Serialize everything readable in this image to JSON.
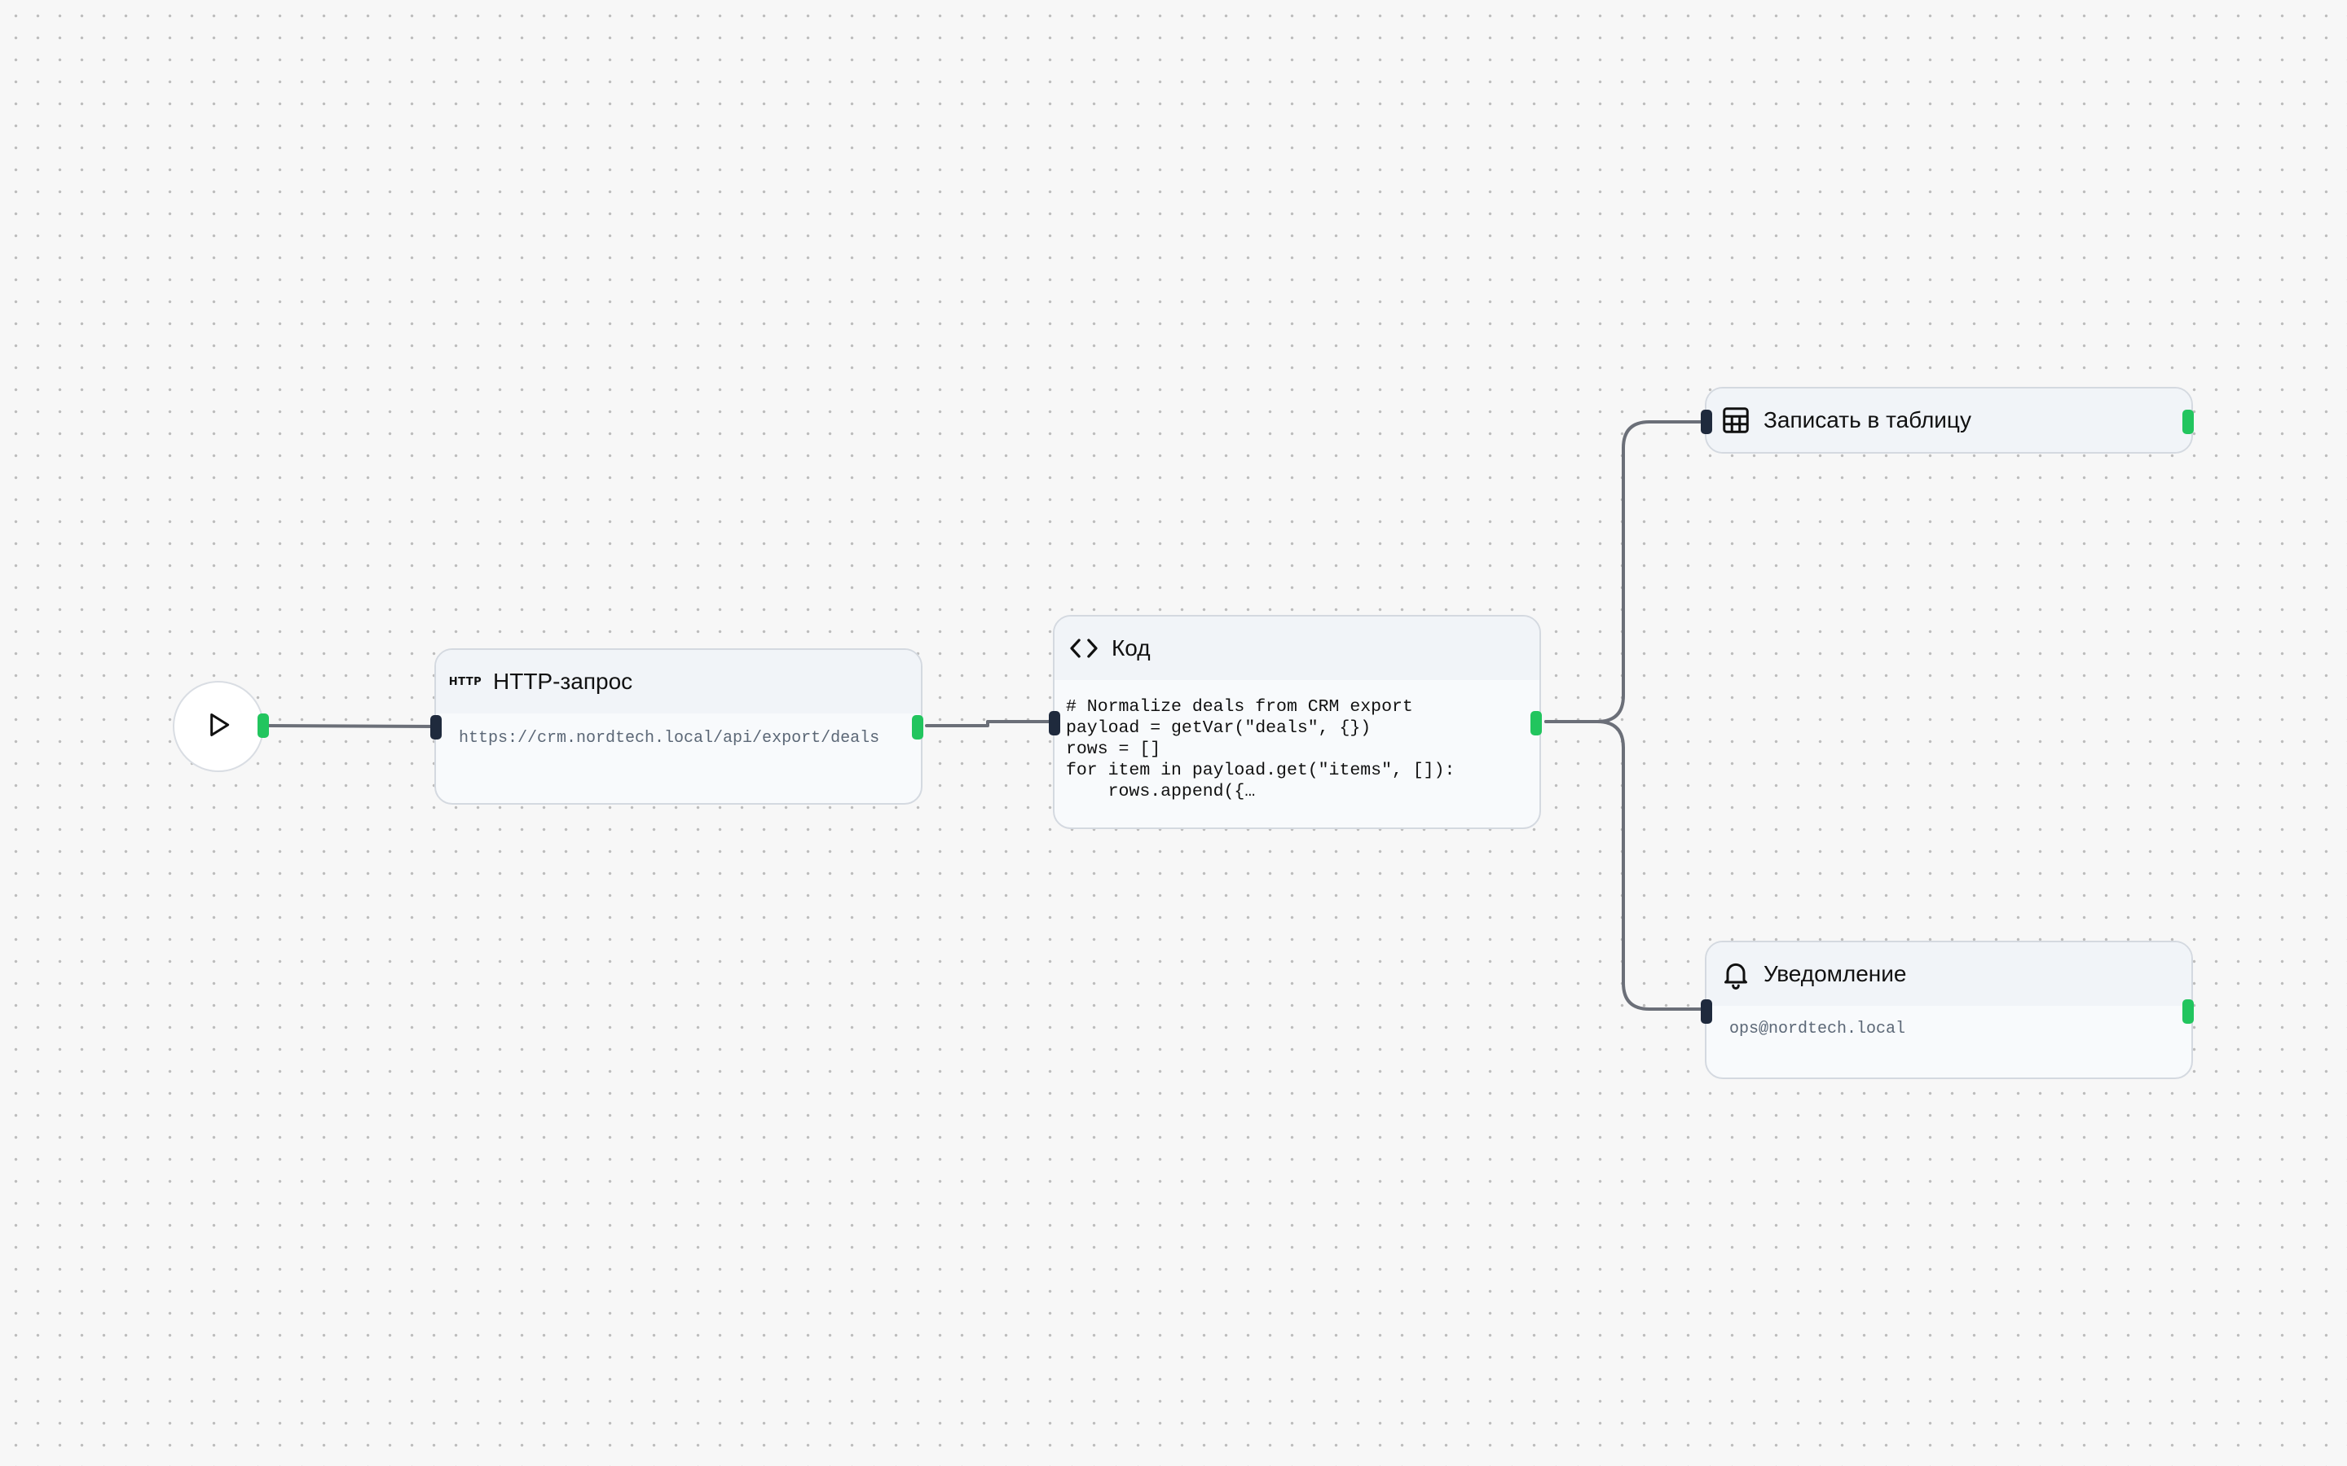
{
  "colors": {
    "canvas_bg": "#f7f7f7",
    "grid_dot": "#bdbdbd",
    "edge": "#6b6f78",
    "port_in": "#1f2a3d",
    "port_out": "#22c55e",
    "node_border": "#d4d9e0",
    "node_header_bg": "#f1f4f8"
  },
  "workflow": {
    "trigger": {
      "icon": "play-icon"
    },
    "nodes": {
      "http": {
        "icon": "http-icon",
        "icon_text": "HTTP",
        "title": "HTTP-запрос",
        "url": "https://crm.nordtech.local/api/export/deals"
      },
      "code": {
        "icon": "code-icon",
        "title": "Код",
        "code": "# Normalize deals from CRM export\npayload = getVar(\"deals\", {})\nrows = []\nfor item in payload.get(\"items\", []):\n    rows.append({…"
      },
      "sheet": {
        "icon": "table-icon",
        "title": "Записать в таблицу"
      },
      "notify": {
        "icon": "bell-icon",
        "title": "Уведомление",
        "recipient": "ops@nordtech.local"
      }
    }
  }
}
